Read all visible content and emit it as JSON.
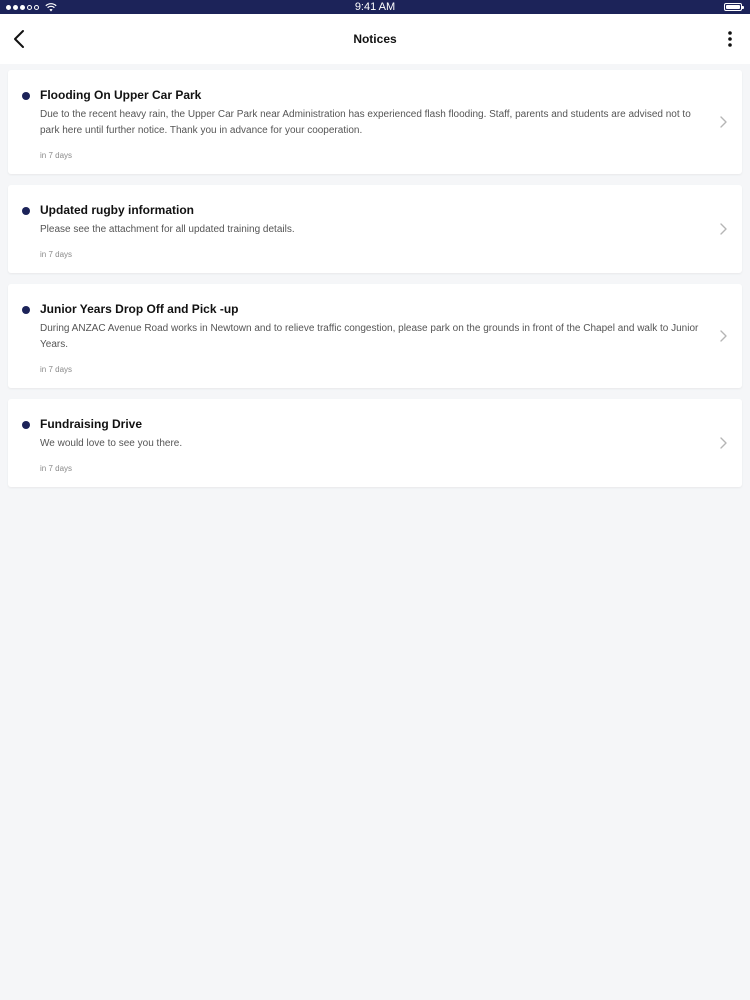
{
  "status_bar": {
    "time": "9:41 AM",
    "signal_icon": "cellular-signal-icon",
    "wifi_icon": "wifi-icon",
    "battery_icon": "battery-icon"
  },
  "nav": {
    "title": "Notices",
    "back_icon": "chevron-left-icon",
    "more_icon": "more-vertical-icon"
  },
  "colors": {
    "brand": "#1c2359",
    "background": "#f5f6f8",
    "card": "#ffffff",
    "text_primary": "#111111",
    "text_secondary": "#555555",
    "text_muted": "#8a8a8a"
  },
  "notices": [
    {
      "title": "Flooding On Upper Car Park",
      "body": "Due to the recent heavy rain, the Upper Car Park near Administration has experienced flash flooding. Staff, parents and students are advised not to park here until further notice. Thank you in advance for your cooperation.",
      "time": "in 7 days"
    },
    {
      "title": "Updated rugby information",
      "body": "Please see the attachment for all updated training details.",
      "time": "in 7 days"
    },
    {
      "title": "Junior Years Drop Off and Pick -up",
      "body": "During ANZAC Avenue Road works in Newtown and to relieve traffic congestion, please park on the grounds in front of the Chapel and walk to Junior Years.",
      "time": "in 7 days"
    },
    {
      "title": "Fundraising Drive",
      "body": "We would love to see you there.",
      "time": "in 7 days"
    }
  ]
}
